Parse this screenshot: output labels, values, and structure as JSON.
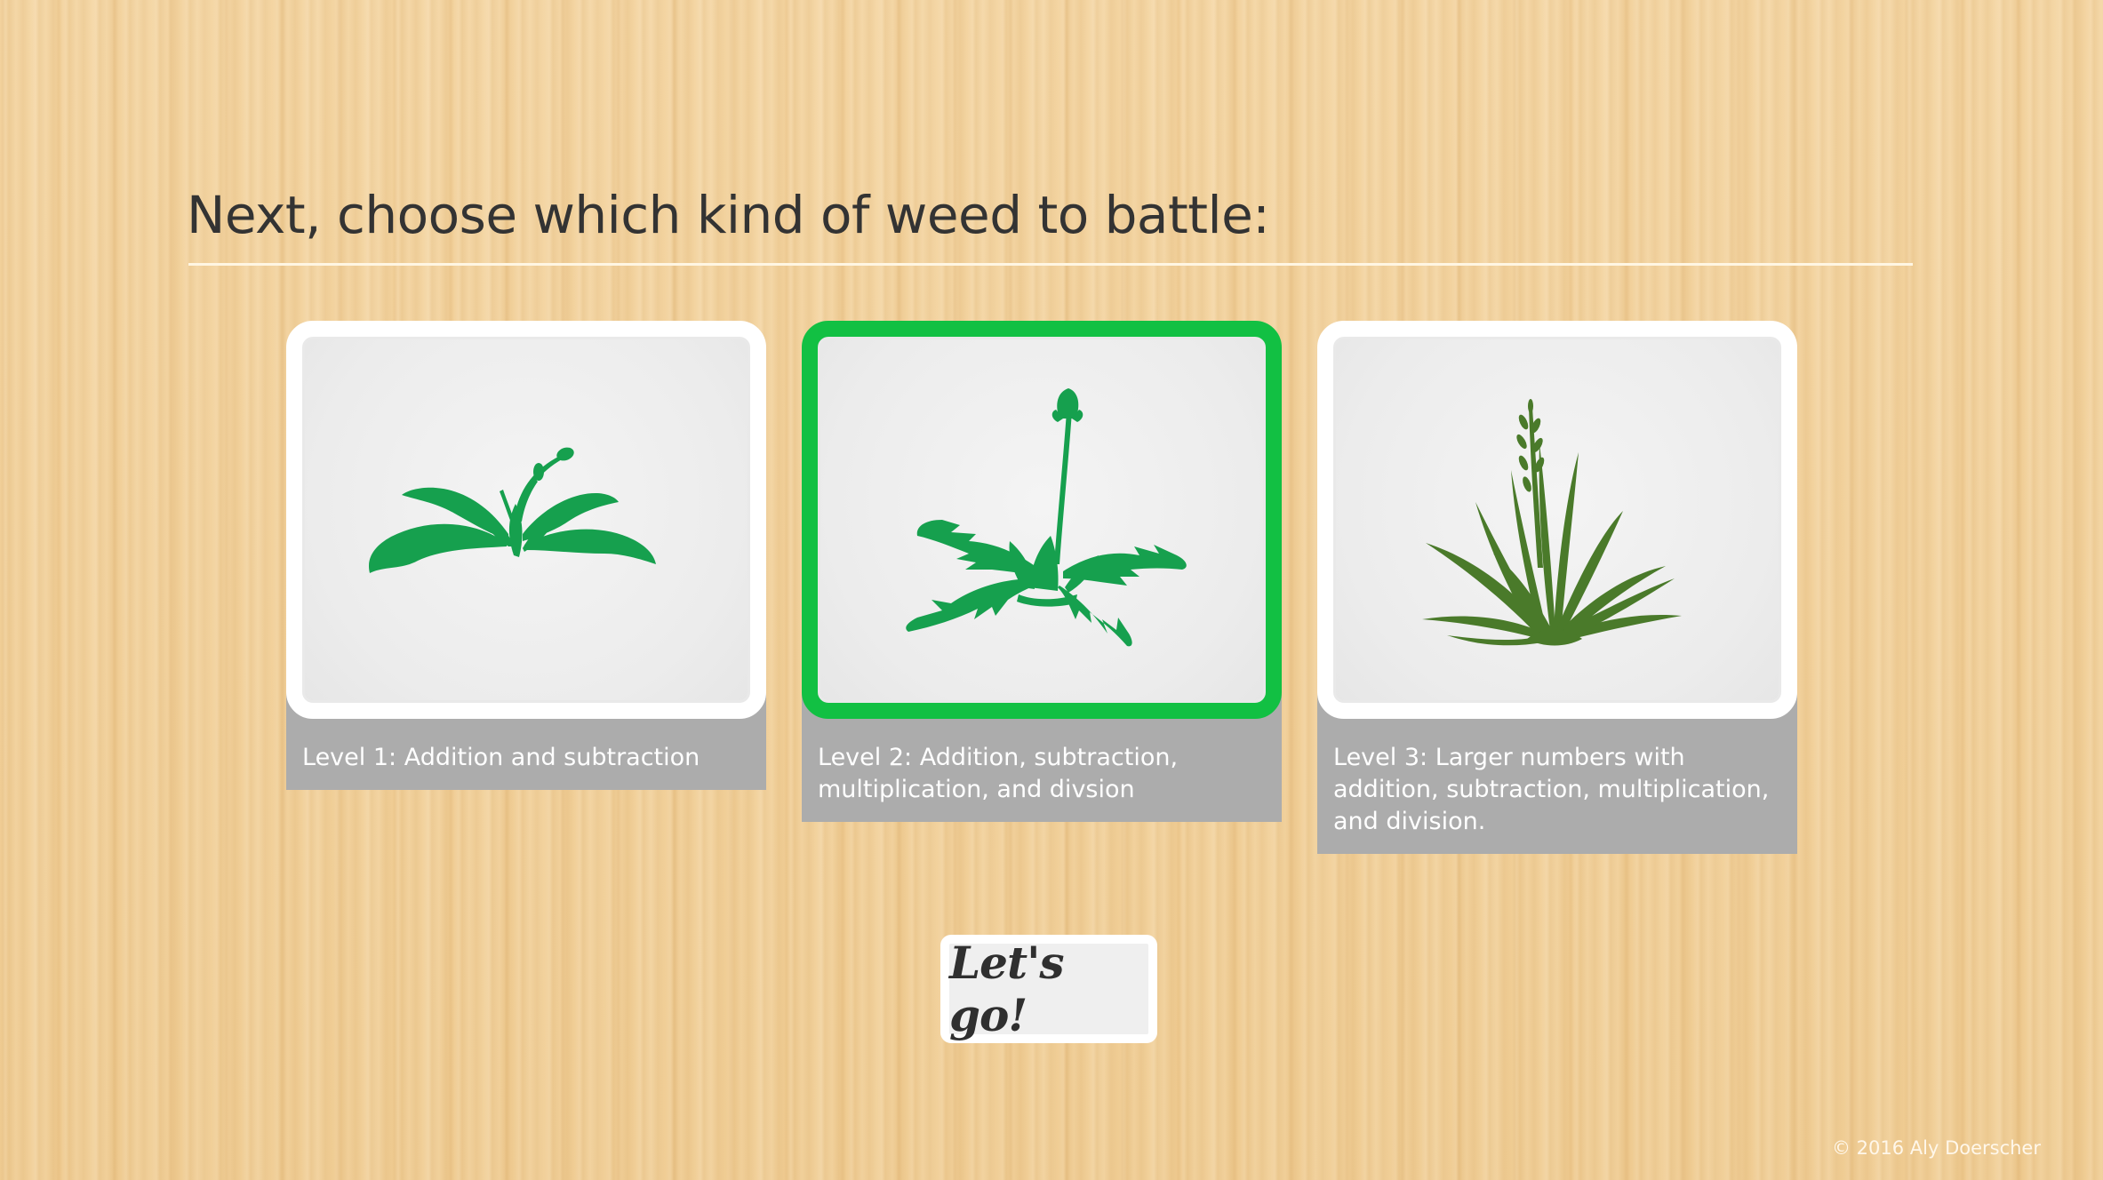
{
  "heading": "Next, choose which kind of weed to battle:",
  "levels": [
    {
      "caption": "Level 1: Addition and subtraction",
      "icon": "plantain-weed-icon",
      "color": "#16a04e",
      "selected": false
    },
    {
      "caption": "Level 2: Addition, subtraction, multiplication, and divsion",
      "icon": "dandelion-weed-icon",
      "color": "#16a04e",
      "selected": true
    },
    {
      "caption": "Level 3: Larger numbers with addition, subtraction, multiplication, and division.",
      "icon": "grass-weed-icon",
      "color": "#4a7a2a",
      "selected": false
    }
  ],
  "button": {
    "label": "Let's go!"
  },
  "footer": "© 2016 Aly Doerscher",
  "colors": {
    "selected_border": "#12c043",
    "caption_bg": "#acacac",
    "background": "#f1cf98"
  }
}
